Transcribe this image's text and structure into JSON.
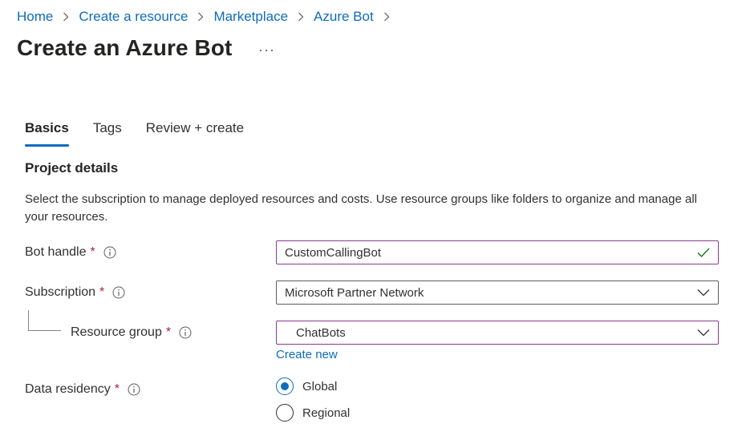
{
  "breadcrumb": {
    "items": [
      {
        "label": "Home"
      },
      {
        "label": "Create a resource"
      },
      {
        "label": "Marketplace"
      },
      {
        "label": "Azure Bot"
      }
    ]
  },
  "header": {
    "title": "Create an Azure Bot",
    "more_label": "···"
  },
  "tabs": [
    {
      "label": "Basics",
      "active": true
    },
    {
      "label": "Tags",
      "active": false
    },
    {
      "label": "Review + create",
      "active": false
    }
  ],
  "project_details": {
    "heading": "Project details",
    "description": "Select the subscription to manage deployed resources and costs. Use resource groups like folders to organize and manage all your resources."
  },
  "fields": {
    "required_marker": "*",
    "bot_handle": {
      "label": "Bot handle",
      "value": "CustomCallingBot",
      "valid_icon": "checkmark-icon"
    },
    "subscription": {
      "label": "Subscription",
      "value": "Microsoft Partner Network"
    },
    "resource_group": {
      "label": "Resource group",
      "value": "ChatBots",
      "create_new_label": "Create new"
    },
    "data_residency": {
      "label": "Data residency",
      "options": [
        {
          "label": "Global",
          "selected": true
        },
        {
          "label": "Regional",
          "selected": false
        }
      ]
    }
  },
  "colors": {
    "link": "#0f6cbd",
    "focus_border": "#8a3a8f",
    "required": "#a4262c",
    "valid": "#107c10"
  }
}
